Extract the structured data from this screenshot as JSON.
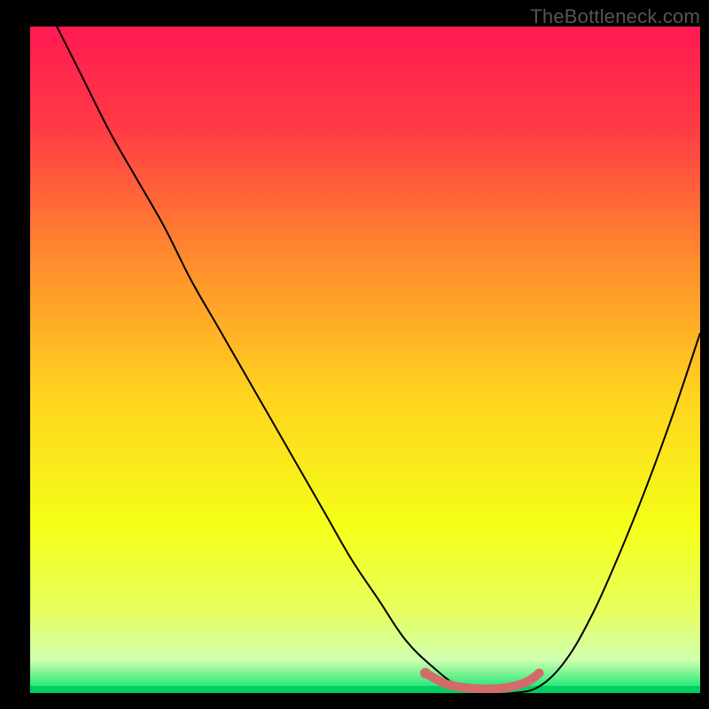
{
  "watermark": "TheBottleneck.com",
  "chart_data": {
    "type": "line",
    "title": "",
    "xlabel": "",
    "ylabel": "",
    "xlim": [
      0,
      100
    ],
    "ylim": [
      0,
      100
    ],
    "background_gradient": {
      "stops": [
        {
          "offset": 0.0,
          "color": "#ff1a52"
        },
        {
          "offset": 0.15,
          "color": "#ff3a45"
        },
        {
          "offset": 0.35,
          "color": "#ff8c2e"
        },
        {
          "offset": 0.55,
          "color": "#ffd21f"
        },
        {
          "offset": 0.75,
          "color": "#f4ff18"
        },
        {
          "offset": 0.88,
          "color": "#e6ff60"
        },
        {
          "offset": 0.95,
          "color": "#d0ffb0"
        },
        {
          "offset": 1.0,
          "color": "#00e26a"
        }
      ]
    },
    "series": [
      {
        "name": "bottleneck-curve",
        "color": "#000000",
        "stroke_width": 2,
        "x": [
          4,
          8,
          12,
          16,
          20,
          24,
          28,
          32,
          36,
          40,
          44,
          48,
          52,
          56,
          60,
          64,
          68,
          72,
          76,
          80,
          84,
          88,
          92,
          96,
          100
        ],
        "y": [
          100,
          92,
          84,
          77,
          70,
          62,
          55,
          48,
          41,
          34,
          27,
          20,
          14,
          8,
          4,
          1,
          0,
          0,
          1,
          5,
          12,
          21,
          31,
          42,
          54
        ]
      }
    ],
    "highlight": {
      "name": "optimal-range",
      "color": "#d46a6a",
      "stroke_width": 10,
      "linecap": "round",
      "x": [
        59,
        62,
        65,
        68,
        71,
        74,
        76
      ],
      "y": [
        3.0,
        1.4,
        0.8,
        0.6,
        0.8,
        1.6,
        3.0
      ]
    },
    "highlight_start_dot": {
      "x": 59,
      "y": 3.0,
      "r": 6,
      "color": "#d46a6a"
    }
  }
}
